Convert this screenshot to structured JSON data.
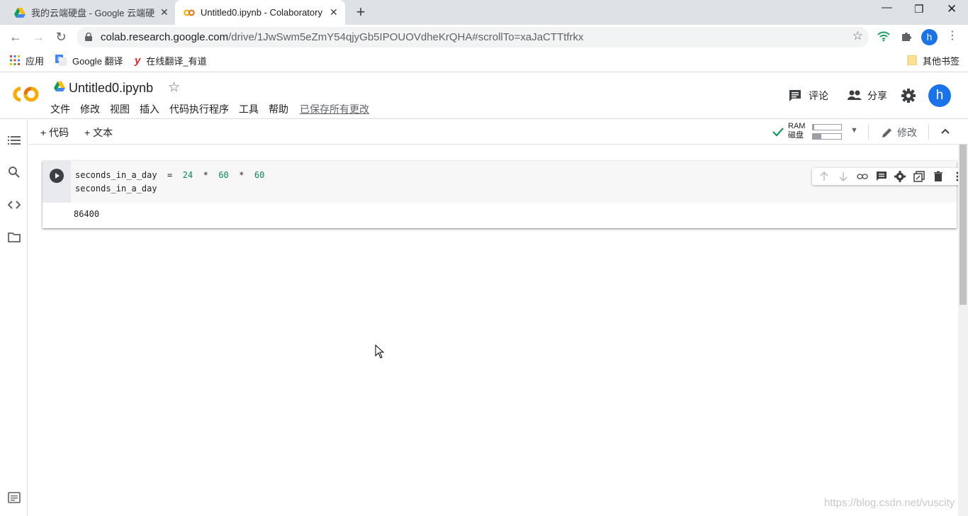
{
  "browser": {
    "tabs": [
      {
        "title": "我的云端硬盘 - Google 云端硬盘",
        "icon": "google-drive-icon",
        "active": false
      },
      {
        "title": "Untitled0.ipynb - Colaboratory",
        "icon": "colab-icon",
        "active": true
      }
    ],
    "new_tab": "+",
    "url_host": "colab.research.google.com",
    "url_path": "/drive/1JwSwm5eZmY54qjyGb5IPOUOVdheKrQHA#scrollTo=xaJaCTTtfrkx",
    "profile_initial": "h",
    "bookmarks": [
      {
        "label": "应用",
        "icon": "apps-grid-icon"
      },
      {
        "label": "Google 翻译",
        "icon": "google-translate-icon"
      },
      {
        "label": "在线翻译_有道",
        "icon": "youdao-icon"
      }
    ],
    "other_bookmarks": "其他书签"
  },
  "colab": {
    "notebook_title": "Untitled0.ipynb",
    "menu": [
      "文件",
      "修改",
      "视图",
      "插入",
      "代码执行程序",
      "工具",
      "帮助"
    ],
    "saved_status": "已保存所有更改",
    "comment_label": "评论",
    "share_label": "分享",
    "avatar_initial": "h",
    "toolbar": {
      "add_code": "+ 代码",
      "add_text": "+ 文本",
      "ram_label": "RAM",
      "disk_label": "磁盘",
      "ram_usage": 0.05,
      "disk_usage": 0.3,
      "edit_label": "修改"
    },
    "cell": {
      "code_line_1": {
        "var": "seconds_in_a_day",
        "op1": "=",
        "n1": "24",
        "op2": "*",
        "n2": "60",
        "op3": "*",
        "n3": "60"
      },
      "code_line_2": "seconds_in_a_day",
      "output": "86400"
    }
  },
  "watermark": "https://blog.csdn.net/vuscity",
  "colors": {
    "accent": "#1a73e8",
    "colab_orange": "#f9ab00",
    "number_green": "#09885a"
  }
}
